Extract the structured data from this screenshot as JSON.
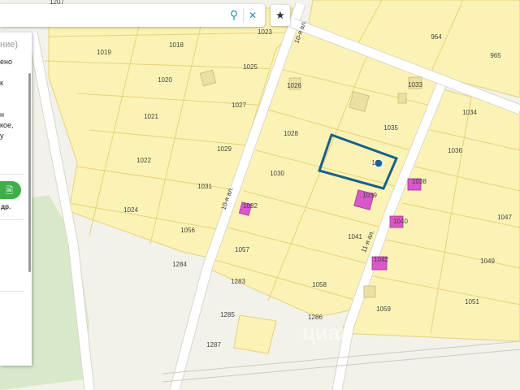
{
  "search": {
    "value": "",
    "placeholder": "",
    "search_icon": "magnifier-icon",
    "clear_icon": "close-icon"
  },
  "favorite_icon": "star-icon",
  "panel": {
    "header": "ние)",
    "text_lines": [
      "ено",
      "",
      "к",
      "",
      "",
      "н",
      "кое,",
      "у"
    ],
    "more": "др."
  },
  "streets": {
    "a": "10-я ал.",
    "b": "10-я ал.",
    "c": "11-я ал."
  },
  "parcels": [
    "1207",
    "1023",
    "964",
    "965",
    "1019",
    "1018",
    "1025",
    "1026",
    "1033",
    "1020",
    "1027",
    "1034",
    "1021",
    "1028",
    "1035",
    "1036",
    "1022",
    "1029",
    "1030",
    "1031",
    "1038",
    "1024",
    "1032",
    "1039",
    "1040",
    "1047",
    "1056",
    "1041",
    "1057",
    "1042",
    "1049",
    "1284",
    "1283",
    "1058",
    "1059",
    "1051",
    "1285",
    "1286",
    "1287"
  ],
  "selected_label": "10",
  "watermark": "циан"
}
